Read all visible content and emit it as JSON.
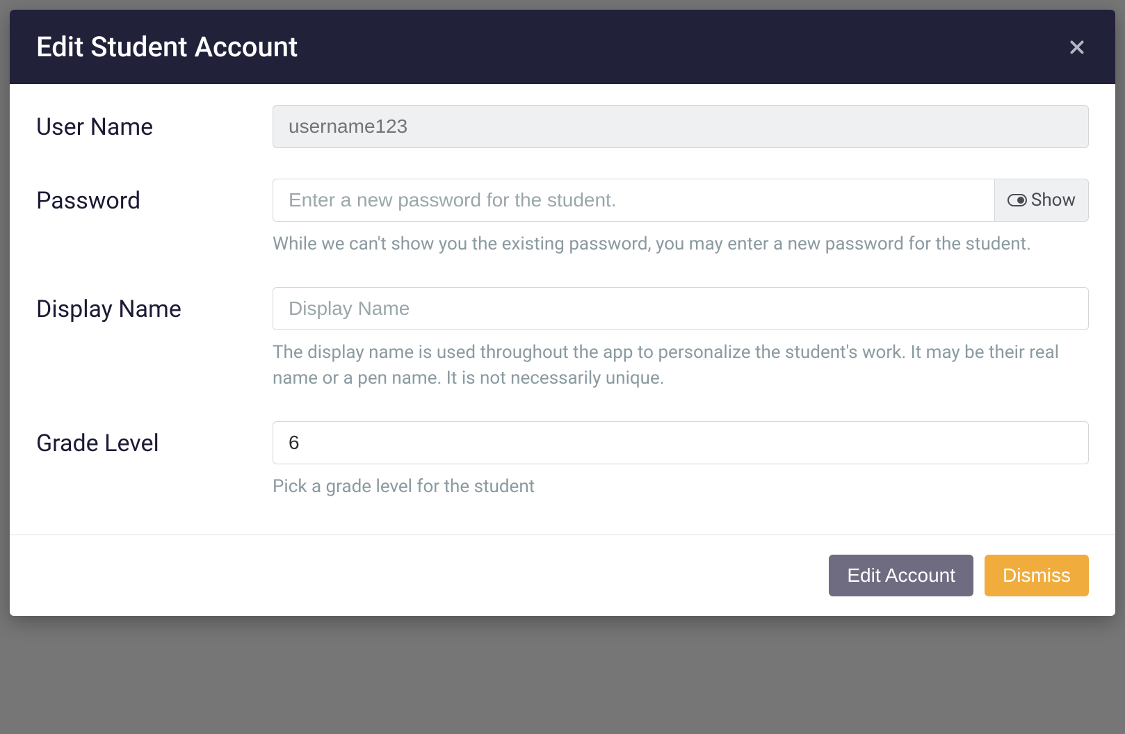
{
  "modal": {
    "title": "Edit Student Account"
  },
  "fields": {
    "username": {
      "label": "User Name",
      "value": "username123"
    },
    "password": {
      "label": "Password",
      "placeholder": "Enter a new password for the student.",
      "show_label": "Show",
      "help": "While we can't show you the existing password, you may enter a new password for the student."
    },
    "display_name": {
      "label": "Display Name",
      "placeholder": "Display Name",
      "help": "The display name is used throughout the app to personalize the student's work. It may be their real name or a pen name. It is not necessarily unique."
    },
    "grade_level": {
      "label": "Grade Level",
      "value": "6",
      "help": "Pick a grade level for the student"
    }
  },
  "footer": {
    "edit_label": "Edit Account",
    "dismiss_label": "Dismiss"
  }
}
